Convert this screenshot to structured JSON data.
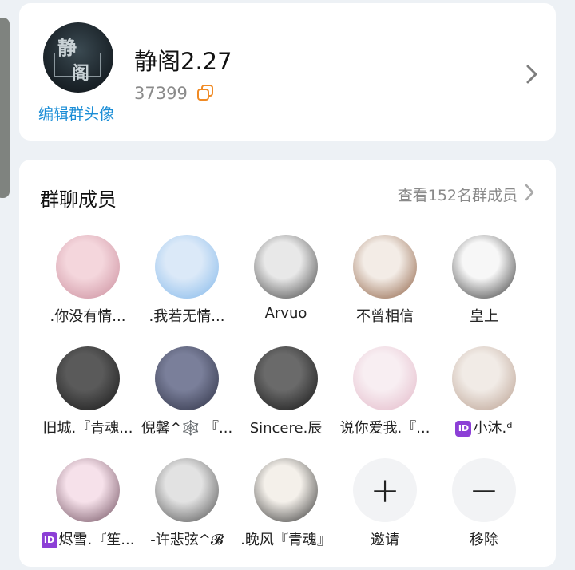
{
  "group": {
    "avatar_glyphs": [
      "静",
      "阁"
    ],
    "edit_avatar_label": "编辑群头像",
    "name": "静阁2.27",
    "id": "37399"
  },
  "members": {
    "title": "群聊成员",
    "view_all_label": "查看152名群成员",
    "list": [
      {
        "name": ".你没有情...",
        "colors": [
          "#f4d6dc",
          "#c98a9a"
        ]
      },
      {
        "name": ".我若无情...",
        "colors": [
          "#dbe9f8",
          "#7fb6ea"
        ]
      },
      {
        "name": "Arvuo",
        "colors": [
          "#e8e8e8",
          "#3d3d3d"
        ]
      },
      {
        "name": "不曾相信",
        "colors": [
          "#f3ece6",
          "#8a5a3c"
        ]
      },
      {
        "name": "皇上",
        "colors": [
          "#f7f7f7",
          "#333333"
        ]
      },
      {
        "name": "旧城.『青魂...",
        "colors": [
          "#5a5a5a",
          "#151515"
        ]
      },
      {
        "name": "倪馨^🕸️ 『...",
        "colors": [
          "#7a7f9a",
          "#2a2d40"
        ]
      },
      {
        "name": "Sincere.辰",
        "colors": [
          "#6a6a6a",
          "#111111"
        ]
      },
      {
        "name": "说你爱我.『...",
        "colors": [
          "#f8eef2",
          "#e2b6c6"
        ]
      },
      {
        "name": "小沐.ᵈ",
        "badge": "ID",
        "colors": [
          "#f1ebe6",
          "#b79c8c"
        ]
      },
      {
        "name": "烬雪.『笙...",
        "badge": "ID",
        "colors": [
          "#f6e1ea",
          "#6b4a5a"
        ]
      },
      {
        "name": "-许悲弦^𝓑",
        "colors": [
          "#e2e2e2",
          "#4a4a4a"
        ]
      },
      {
        "name": ".晚风『青魂』",
        "colors": [
          "#f4f0ea",
          "#2e2e2e"
        ]
      }
    ],
    "invite": {
      "label": "邀请",
      "symbol": "+"
    },
    "remove": {
      "label": "移除",
      "symbol": "−"
    }
  },
  "colors": {
    "accent_link": "#1a8dd6",
    "copy_icon": "#f08a24",
    "badge": "#8c3fd6",
    "page_bg": "#edf1f5"
  },
  "icons": [
    "copy-icon",
    "chevron-right-icon",
    "plus-icon",
    "minus-icon"
  ]
}
